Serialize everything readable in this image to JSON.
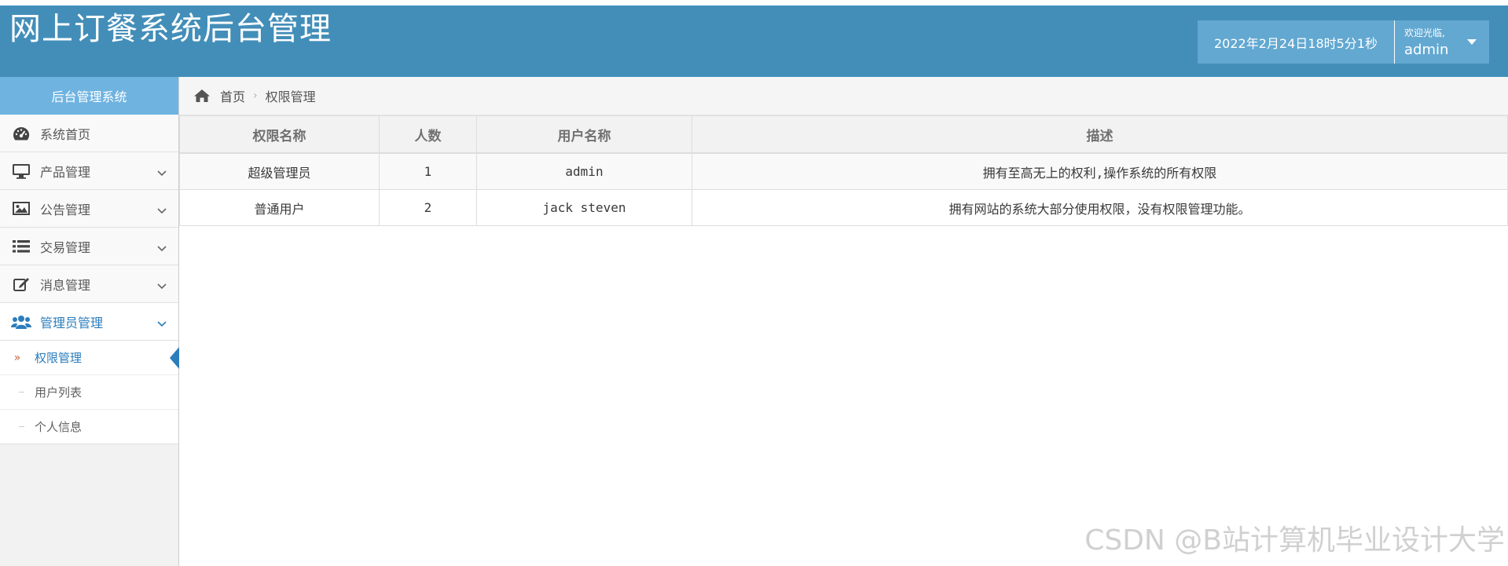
{
  "header": {
    "title": "网上订餐系统后台管理",
    "datetime": "2022年2月24日18时5分1秒",
    "welcome": "欢迎光临,",
    "username": "admin"
  },
  "sidebar": {
    "title": "后台管理系统",
    "items": [
      {
        "label": "系统首页",
        "icon": "dashboard-icon"
      },
      {
        "label": "产品管理",
        "icon": "desktop-icon"
      },
      {
        "label": "公告管理",
        "icon": "picture-icon"
      },
      {
        "label": "交易管理",
        "icon": "list-icon"
      },
      {
        "label": "消息管理",
        "icon": "edit-icon"
      },
      {
        "label": "管理员管理",
        "icon": "users-icon",
        "active": true
      }
    ],
    "submenu": [
      {
        "label": "权限管理",
        "active": true
      },
      {
        "label": "用户列表"
      },
      {
        "label": "个人信息"
      }
    ]
  },
  "breadcrumb": {
    "home": "首页",
    "separator": "›",
    "current": "权限管理"
  },
  "table": {
    "columns": [
      "权限名称",
      "人数",
      "用户名称",
      "描述"
    ],
    "rows": [
      [
        "超级管理员",
        "1",
        "admin",
        "拥有至高无上的权利,操作系统的所有权限"
      ],
      [
        "普通用户",
        "2",
        "jack steven",
        "拥有网站的系统大部分使用权限，没有权限管理功能。"
      ]
    ]
  },
  "watermark": "CSDN @B站计算机毕业设计大学",
  "colors": {
    "header_bg": "#438eb9",
    "sidebar_header_bg": "#6fb3e0",
    "accent": "#2b7dbc"
  }
}
